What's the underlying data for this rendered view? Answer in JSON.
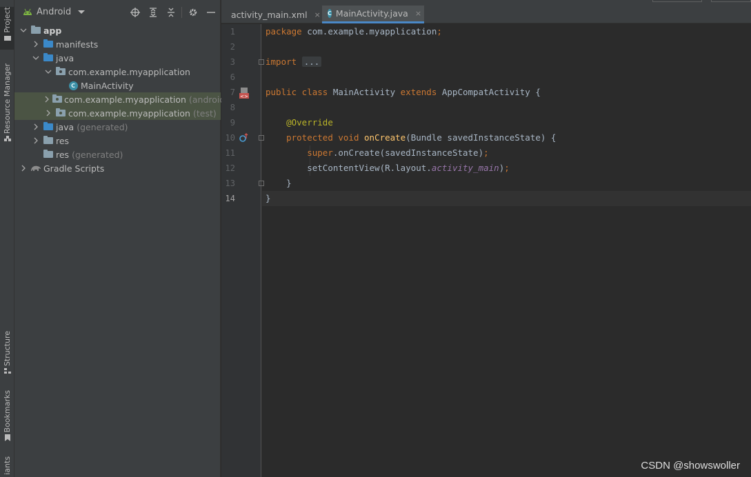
{
  "tool_strip": {
    "tabs": [
      {
        "label": "Project"
      },
      {
        "label": "Resource Manager"
      },
      {
        "label": "Structure"
      },
      {
        "label": "Bookmarks"
      },
      {
        "label": "iants"
      }
    ]
  },
  "project_panel": {
    "view_title": "Android",
    "tree": [
      {
        "label": "app",
        "suffix": ""
      },
      {
        "label": "manifests",
        "suffix": ""
      },
      {
        "label": "java",
        "suffix": ""
      },
      {
        "label": "com.example.myapplication",
        "suffix": ""
      },
      {
        "label": "MainActivity",
        "suffix": ""
      },
      {
        "label": "com.example.myapplication",
        "suffix": "(androidT"
      },
      {
        "label": "com.example.myapplication",
        "suffix": "(test)"
      },
      {
        "label": "java",
        "suffix": "(generated)"
      },
      {
        "label": "res",
        "suffix": ""
      },
      {
        "label": "res",
        "suffix": "(generated)"
      },
      {
        "label": "Gradle Scripts",
        "suffix": ""
      }
    ]
  },
  "editor": {
    "tabs": [
      {
        "label": "activity_main.xml",
        "close": "×"
      },
      {
        "label": "MainActivity.java",
        "close": "×"
      }
    ],
    "line_numbers": [
      "1",
      "2",
      "3",
      "6",
      "7",
      "8",
      "9",
      "10",
      "11",
      "12",
      "13",
      "14"
    ],
    "code": {
      "l1_kw": "package",
      "l1_rest": " com.example.myapplication",
      "l1_semi": ";",
      "l3_kw": "import",
      "l3_dots": "...",
      "l7_kw1": "public class",
      "l7_name": " MainActivity ",
      "l7_kw2": "extends",
      "l7_rest": " AppCompatActivity {",
      "l10_ann": "@Override",
      "l11_kw": "protected void",
      "l11_fn": "onCreate",
      "l11_rest": "(Bundle savedInstanceState) {",
      "l12_kw": "super",
      "l12_rest": ".onCreate(savedInstanceState)",
      "l12_semi": ";",
      "l13_rest": "setContentView(R.layout.",
      "l13_ital": "activity_main",
      "l13_end": ")",
      "l13_semi": ";",
      "l14": "}",
      "l15": "}"
    }
  },
  "watermark": "CSDN @showswoller",
  "colors": {
    "keyword": "#cc7832",
    "annotation": "#bbb529",
    "method": "#ffc66d",
    "field": "#9876aa",
    "text": "#a9b7c6",
    "accent": "#4a88c7"
  }
}
